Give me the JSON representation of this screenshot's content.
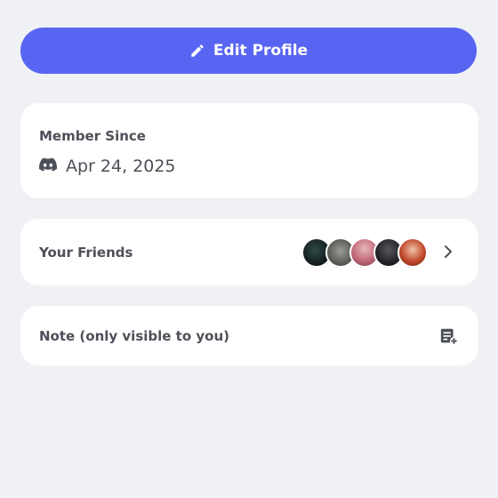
{
  "edit_profile": {
    "label": "Edit Profile",
    "icon": "pencil-icon",
    "color": "#5865f2"
  },
  "member_since": {
    "title": "Member Since",
    "icon": "discord-icon",
    "date": "Apr 24, 2025"
  },
  "friends": {
    "label": "Your Friends",
    "avatars": [
      {
        "icon": "friend-avatar-1",
        "color": "#1c2a2a"
      },
      {
        "icon": "friend-avatar-2",
        "color": "#6b6f6b"
      },
      {
        "icon": "friend-avatar-3",
        "color": "#c97f8a"
      },
      {
        "icon": "friend-avatar-4",
        "color": "#2a2a2e"
      },
      {
        "icon": "friend-avatar-5",
        "color": "#b8442a"
      }
    ],
    "chevron_icon": "chevron-right-icon"
  },
  "note": {
    "label": "Note (only visible to you)",
    "icon": "note-add-icon"
  }
}
